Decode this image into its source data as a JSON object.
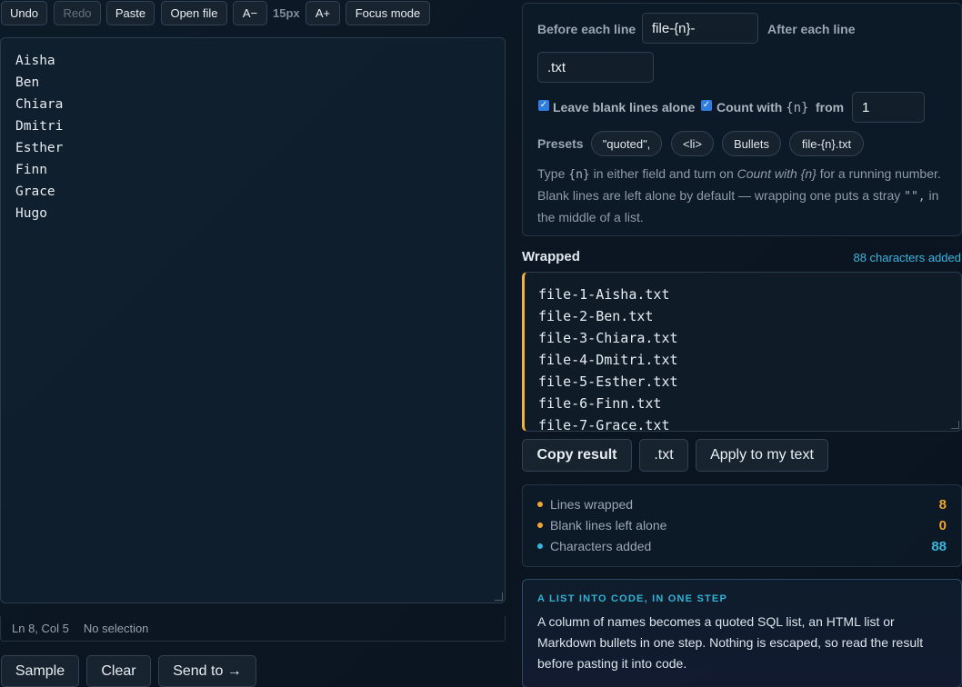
{
  "toolbar": {
    "undo": "Undo",
    "redo": "Redo",
    "paste": "Paste",
    "open_file": "Open file",
    "font_smaller": "A−",
    "font_size": "15px",
    "font_larger": "A+",
    "focus_mode": "Focus mode"
  },
  "editor": {
    "lines": [
      "Aisha",
      "Ben",
      "Chiara",
      "Dmitri",
      "Esther",
      "Finn",
      "Grace",
      "Hugo"
    ]
  },
  "status": {
    "cursor": "Ln 8, Col 5",
    "selection": "No selection"
  },
  "bottom_buttons": {
    "sample": "Sample",
    "clear": "Clear",
    "send_to": "Send to →"
  },
  "options": {
    "before_label": "Before each line",
    "before_value": "file-{n}-",
    "after_label": "After each line",
    "after_value": ".txt",
    "leave_blank_label": "Leave blank lines alone",
    "count_label_prefix": "Count with",
    "count_token": "{n}",
    "from_label": "from",
    "from_value": "1",
    "presets_label": "Presets",
    "presets": [
      "\"quoted\",",
      "<li>",
      "Bullets",
      "file-{n}.txt"
    ],
    "help_1": "Type",
    "help_token": "{n}",
    "help_2": "in either field and turn on",
    "help_em": "Count with {n}",
    "help_3": "for a running number. Blank lines are left alone by default — wrapping one puts a stray",
    "help_code2": "\"\",",
    "help_4": "in the middle of a list."
  },
  "output": {
    "title": "Wrapped",
    "chars_added": "88 characters added",
    "lines": [
      "file-1-Aisha.txt",
      "file-2-Ben.txt",
      "file-3-Chiara.txt",
      "file-4-Dmitri.txt",
      "file-5-Esther.txt",
      "file-6-Finn.txt",
      "file-7-Grace.txt"
    ]
  },
  "actions": {
    "copy": "Copy result",
    "download": ".txt",
    "apply": "Apply to my text"
  },
  "stats": [
    {
      "label": "Lines wrapped",
      "value": "8",
      "color": "#f0a531"
    },
    {
      "label": "Blank lines left alone",
      "value": "0",
      "color": "#f0a531"
    },
    {
      "label": "Characters added",
      "value": "88",
      "color": "#35b6df"
    }
  ],
  "note": {
    "kicker": "A LIST INTO CODE, IN ONE STEP",
    "body": "A column of names becomes a quoted SQL list, an HTML list or Markdown bullets in one step. Nothing is escaped, so read the result before pasting it into code."
  },
  "colors": {
    "accent_orange": "#f0b43c",
    "accent_cyan": "#35b6df",
    "checkbox_blue": "#2f7de1"
  }
}
